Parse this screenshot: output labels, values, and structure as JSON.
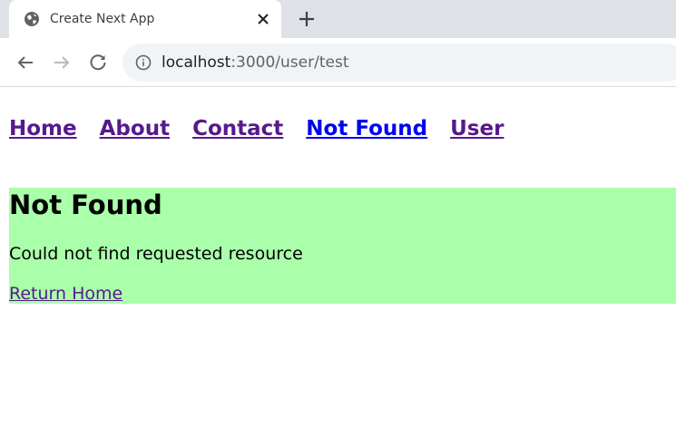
{
  "browser": {
    "tab": {
      "title": "Create Next App",
      "icon": "globe-icon",
      "close_icon": "close-icon"
    },
    "new_tab_icon": "plus-icon",
    "toolbar": {
      "back_icon": "back-arrow-icon",
      "forward_icon": "forward-arrow-icon",
      "reload_icon": "reload-icon",
      "info_icon": "info-icon",
      "url_host": "localhost",
      "url_path": ":3000/user/test"
    }
  },
  "page": {
    "nav": {
      "items": [
        {
          "label": "Home",
          "state": "visited"
        },
        {
          "label": "About",
          "state": "visited"
        },
        {
          "label": "Contact",
          "state": "visited"
        },
        {
          "label": "Not Found",
          "state": "unvisited"
        },
        {
          "label": "User",
          "state": "visited"
        }
      ]
    },
    "not_found": {
      "title": "Not Found",
      "message": "Could not find requested resource",
      "link_label": "Return Home",
      "background_color": "#aaffaa"
    },
    "colors": {
      "visited_link": "#551a8b",
      "unvisited_link": "#0000ee"
    }
  }
}
